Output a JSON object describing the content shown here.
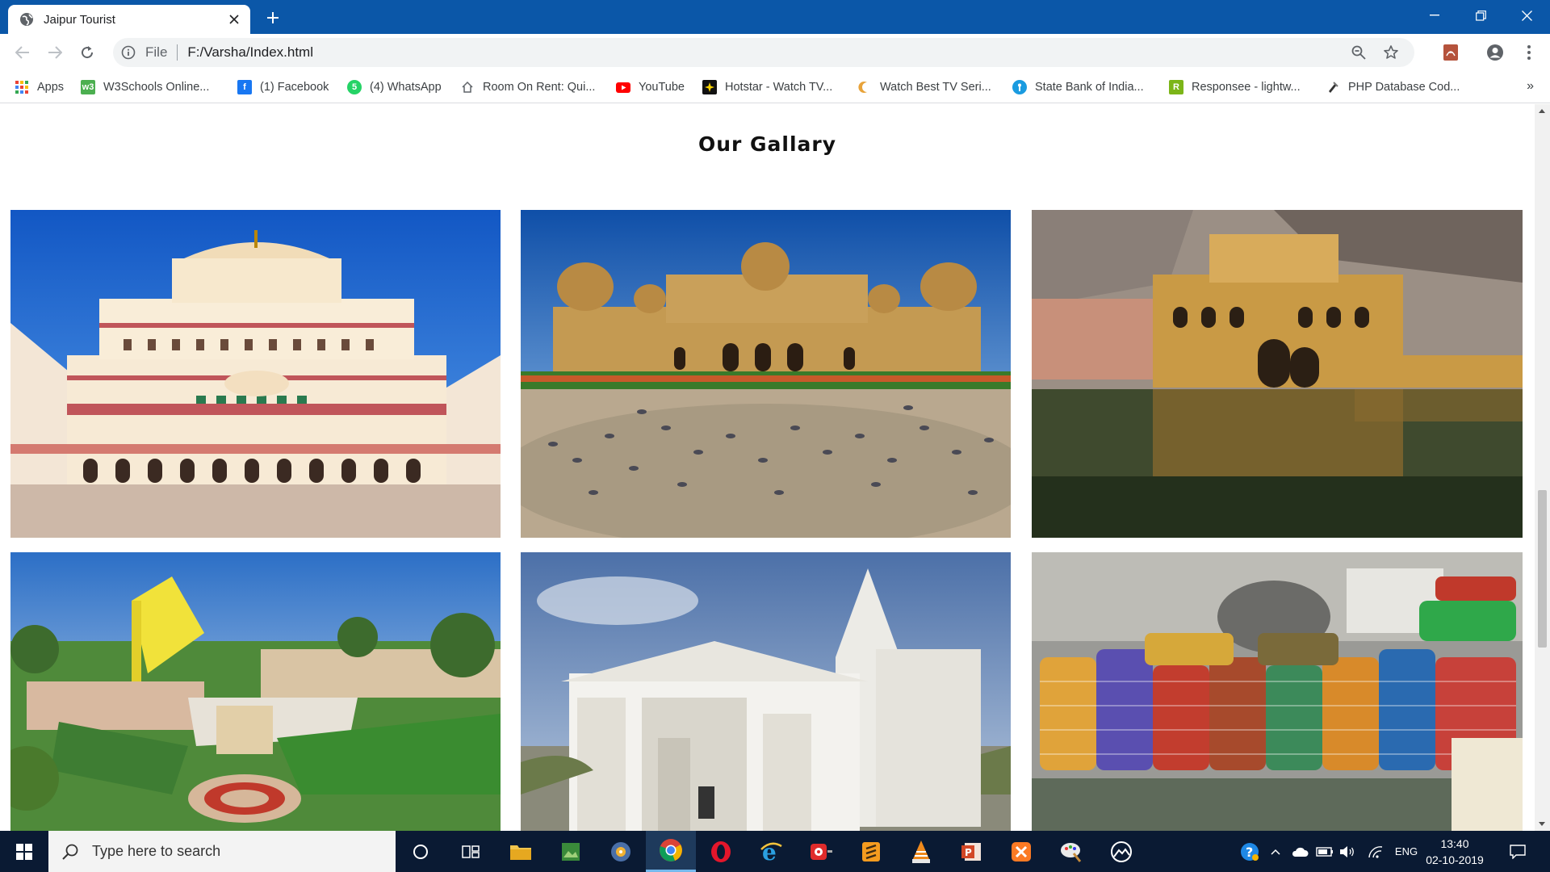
{
  "tab": {
    "title": "Jaipur Tourist"
  },
  "omnibox": {
    "scheme": "File",
    "url": "F:/Varsha/Index.html"
  },
  "bookmarks": [
    {
      "label": "Apps",
      "icon": "apps-grid-icon"
    },
    {
      "label": "W3Schools Online...",
      "icon": "w3schools-icon"
    },
    {
      "label": "(1) Facebook",
      "icon": "facebook-icon"
    },
    {
      "label": "(4) WhatsApp",
      "icon": "whatsapp-icon"
    },
    {
      "label": "Room On Rent: Qui...",
      "icon": "house-icon"
    },
    {
      "label": "YouTube",
      "icon": "youtube-icon"
    },
    {
      "label": "Hotstar - Watch TV...",
      "icon": "hotstar-icon"
    },
    {
      "label": "Watch Best TV Seri...",
      "icon": "moon-icon"
    },
    {
      "label": "State Bank of India...",
      "icon": "sbi-icon"
    },
    {
      "label": "Responsee - lightw...",
      "icon": "responsee-icon"
    },
    {
      "label": "PHP Database Cod...",
      "icon": "php-icon"
    }
  ],
  "page": {
    "gallery_title": "Our Gallary",
    "photos": [
      {
        "subject": "city-palace"
      },
      {
        "subject": "albert-hall-museum"
      },
      {
        "subject": "galta-ji-temple"
      },
      {
        "subject": "jantar-mantar"
      },
      {
        "subject": "birla-mandir"
      },
      {
        "subject": "bangle-market"
      }
    ]
  },
  "taskbar": {
    "search_placeholder": "Type here to search",
    "language": "ENG",
    "time": "13:40",
    "date": "02-10-2019"
  },
  "colors": {
    "titlebar": "#0b57a8",
    "taskbar": "#0a1a33",
    "accent": "#76b9ed"
  }
}
